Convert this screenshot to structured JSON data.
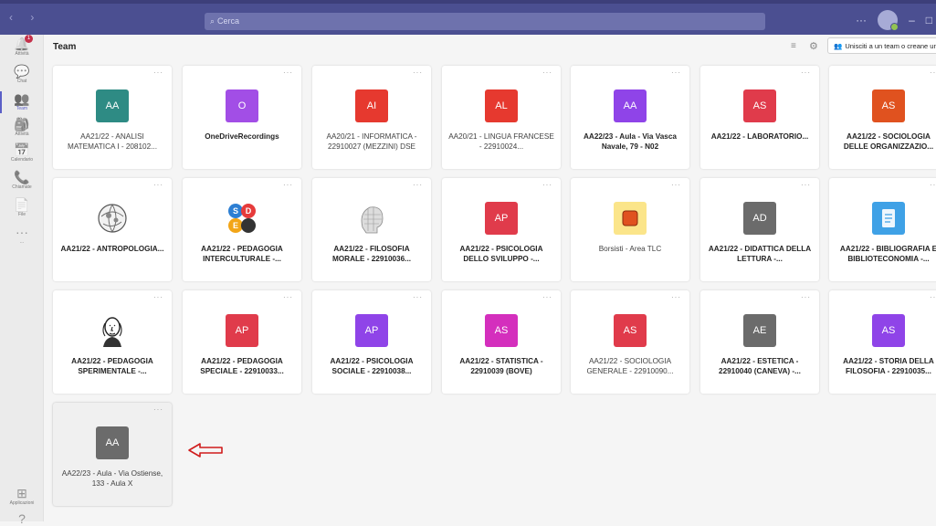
{
  "search": {
    "placeholder": "Cerca"
  },
  "rail": [
    {
      "label": "Attività",
      "icon": "bell-icon",
      "badge": "1"
    },
    {
      "label": "Chat",
      "icon": "chat-icon"
    },
    {
      "label": "Team",
      "icon": "teams-icon"
    },
    {
      "label": "Attività",
      "icon": "backpack-icon"
    },
    {
      "label": "Calendario",
      "icon": "calendar-icon"
    },
    {
      "label": "Chiamate",
      "icon": "phone-icon"
    },
    {
      "label": "File",
      "icon": "file-icon"
    },
    {
      "label": "...",
      "icon": "more-icon"
    },
    {
      "label": "Applicazioni",
      "icon": "apps-icon"
    },
    {
      "label": "",
      "icon": "help-icon"
    }
  ],
  "header": {
    "title": "Team",
    "join_label": "Unisciti a un team o creane uno"
  },
  "teams": [
    {
      "name": "AA21/22 - ANALISI MATEMATICA I - 208102...",
      "initials": "AA",
      "color": "#2e8b84",
      "bold": false
    },
    {
      "name": "OneDriveRecordings",
      "initials": "O",
      "color": "#a24ee6",
      "bold": true
    },
    {
      "name": "AA20/21 - INFORMATICA - 22910027 (MEZZINI) DSE",
      "initials": "AI",
      "color": "#e6392f",
      "bold": false
    },
    {
      "name": "AA20/21 - LINGUA FRANCESE - 22910024...",
      "initials": "AL",
      "color": "#e6392f",
      "bold": false
    },
    {
      "name": "AA22/23 - Aula - Via Vasca Navale, 79 - N02",
      "initials": "AA",
      "color": "#8f44e8",
      "bold": true
    },
    {
      "name": "AA21/22 - LABORATORIO...",
      "initials": "AS",
      "color": "#e03b4b",
      "bold": true
    },
    {
      "name": "AA21/22 - SOCIOLOGIA DELLE ORGANIZZAZIO...",
      "initials": "AS",
      "color": "#e0521f",
      "bold": true
    },
    {
      "name": "AA21/22 - ANTROPOLOGIA...",
      "initials": "",
      "image": "globe-drawing",
      "bold": true
    },
    {
      "name": "AA21/22 - PEDAGOGIA INTERCULTURALE -...",
      "initials": "",
      "image": "sde-logo",
      "bold": true
    },
    {
      "name": "AA21/22 - FILOSOFIA MORALE - 22910036...",
      "initials": "",
      "image": "head-drawing",
      "bold": true
    },
    {
      "name": "AA21/22 - PSICOLOGIA DELLO SVILUPPO -...",
      "initials": "AP",
      "color": "#e03b4b",
      "bold": true
    },
    {
      "name": "Borsisti - Area TLC",
      "initials": "",
      "image": "orange-square",
      "bold": false
    },
    {
      "name": "AA21/22 - DIDATTICA DELLA LETTURA -...",
      "initials": "AD",
      "color": "#6b6b6b",
      "bold": true
    },
    {
      "name": "AA21/22 - BIBLIOGRAFIA E BIBLIOTECONOMIA -...",
      "initials": "",
      "image": "document-icon",
      "bold": true
    },
    {
      "name": "AA21/22 - PEDAGOGIA SPERIMENTALE -...",
      "initials": "",
      "image": "portrait-drawing",
      "bold": true
    },
    {
      "name": "AA21/22 - PEDAGOGIA SPECIALE - 22910033...",
      "initials": "AP",
      "color": "#e03b4b",
      "bold": true
    },
    {
      "name": "AA21/22 - PSICOLOGIA SOCIALE - 22910038...",
      "initials": "AP",
      "color": "#8f44e8",
      "bold": true
    },
    {
      "name": "AA21/22 - STATISTICA - 22910039 (BOVE)",
      "initials": "AS",
      "color": "#d42fbd",
      "bold": true
    },
    {
      "name": "AA21/22 - SOCIOLOGIA GENERALE - 22910090...",
      "initials": "AS",
      "color": "#e03b4b",
      "bold": false
    },
    {
      "name": "AA21/22 - ESTETICA - 22910040 (CANEVA) -...",
      "initials": "AE",
      "color": "#6b6b6b",
      "bold": true
    },
    {
      "name": "AA21/22 - STORIA DELLA FILOSOFIA - 22910035...",
      "initials": "AS",
      "color": "#8f44e8",
      "bold": true
    },
    {
      "name": "AA22/23 - Aula - Via Ostiense, 133 - Aula X",
      "initials": "AA",
      "color": "#6b6b6b",
      "bold": false
    }
  ]
}
